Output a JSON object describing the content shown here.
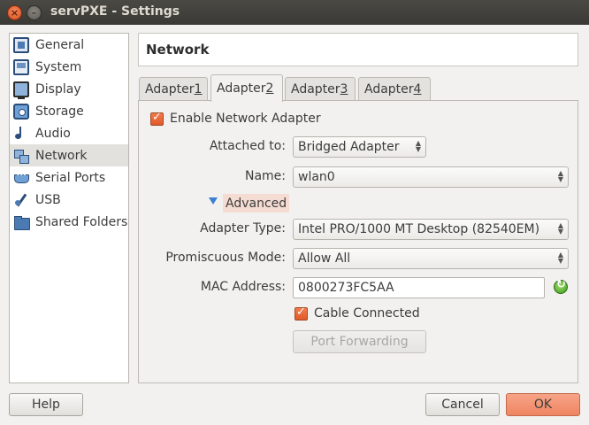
{
  "window": {
    "title": "servPXE - Settings",
    "close_glyph": "×",
    "minimize_glyph": "–"
  },
  "sidebar": {
    "items": [
      {
        "label": "General",
        "icon": "general-icon",
        "selected": false
      },
      {
        "label": "System",
        "icon": "system-icon",
        "selected": false
      },
      {
        "label": "Display",
        "icon": "display-icon",
        "selected": false
      },
      {
        "label": "Storage",
        "icon": "storage-icon",
        "selected": false
      },
      {
        "label": "Audio",
        "icon": "audio-icon",
        "selected": false
      },
      {
        "label": "Network",
        "icon": "network-icon",
        "selected": true
      },
      {
        "label": "Serial Ports",
        "icon": "serial-port-icon",
        "selected": false
      },
      {
        "label": "USB",
        "icon": "usb-icon",
        "selected": false
      },
      {
        "label": "Shared Folders",
        "icon": "shared-folder-icon",
        "selected": false
      }
    ]
  },
  "page": {
    "title": "Network"
  },
  "tabs": [
    {
      "label": "Adapter ",
      "mnemonic": "1",
      "active": false
    },
    {
      "label": "Adapter ",
      "mnemonic": "2",
      "active": true
    },
    {
      "label": "Adapter ",
      "mnemonic": "3",
      "active": false
    },
    {
      "label": "Adapter ",
      "mnemonic": "4",
      "active": false
    }
  ],
  "adapter": {
    "enable_label": "Enable Network Adapter",
    "enable_checked": true,
    "attached_to_label": "Attached to:",
    "attached_to_value": "Bridged Adapter",
    "name_label": "Name:",
    "name_value": "wlan0",
    "advanced_label": "Advanced",
    "adapter_type_label": "Adapter Type:",
    "adapter_type_value": "Intel PRO/1000 MT Desktop (82540EM)",
    "promiscuous_label": "Promiscuous Mode:",
    "promiscuous_value": "Allow All",
    "mac_label": "MAC Address:",
    "mac_value": "0800273FC5AA",
    "cable_label": "Cable Connected",
    "cable_checked": true,
    "port_forwarding_label": "Port Forwarding"
  },
  "buttons": {
    "help": "Help",
    "cancel": "Cancel",
    "ok": "OK"
  },
  "colors": {
    "accent": "#ef8561",
    "checkbox": "#e0592a",
    "selection": "#e3e1dd"
  }
}
